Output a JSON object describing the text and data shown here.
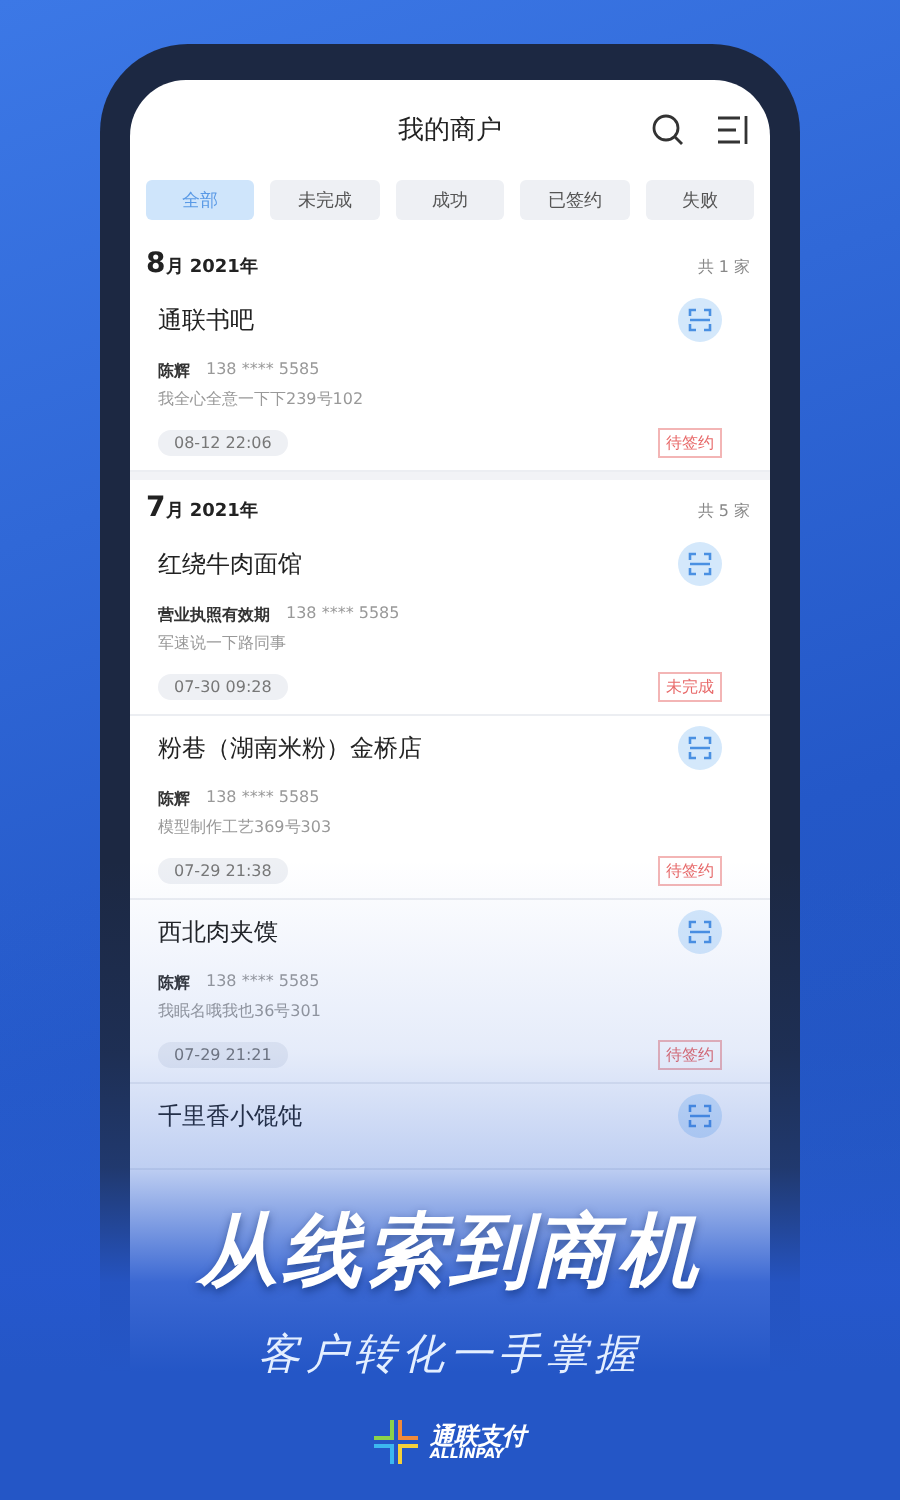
{
  "header": {
    "title": "我的商户"
  },
  "filters": [
    {
      "label": "全部",
      "selected": true
    },
    {
      "label": "未完成",
      "selected": false
    },
    {
      "label": "成功",
      "selected": false
    },
    {
      "label": "已签约",
      "selected": false
    },
    {
      "label": "失败",
      "selected": false
    }
  ],
  "groups": [
    {
      "month": "8",
      "month_unit": "月",
      "year": "2021年",
      "count": "共 1 家",
      "merchants": [
        {
          "name": "通联书吧",
          "contact": "陈辉",
          "phone": "138 **** 5585",
          "address": "我全心全意一下下239号102",
          "time": "08-12 22:06",
          "status": "待签约"
        }
      ]
    },
    {
      "month": "7",
      "month_unit": "月",
      "year": "2021年",
      "count": "共 5 家",
      "merchants": [
        {
          "name": "红绕牛肉面馆",
          "contact": "营业执照有效期",
          "phone": "138 **** 5585",
          "address": "军速说一下路同事",
          "time": "07-30 09:28",
          "status": "未完成"
        },
        {
          "name": "粉巷（湖南米粉）金桥店",
          "contact": "陈辉",
          "phone": "138 **** 5585",
          "address": "模型制作工艺369号303",
          "time": "07-29 21:38",
          "status": "待签约"
        },
        {
          "name": "西北肉夹馍",
          "contact": "陈辉",
          "phone": "138 **** 5585",
          "address": "我眠名哦我也36号301",
          "time": "07-29 21:21",
          "status": "待签约"
        },
        {
          "name": "千里香小馄饨"
        }
      ]
    }
  ],
  "promo": {
    "headline": "从线索到商机",
    "subheadline": "客户转化一手掌握"
  },
  "brand": {
    "name": "通联支付",
    "latin": "ALLINPAY"
  }
}
